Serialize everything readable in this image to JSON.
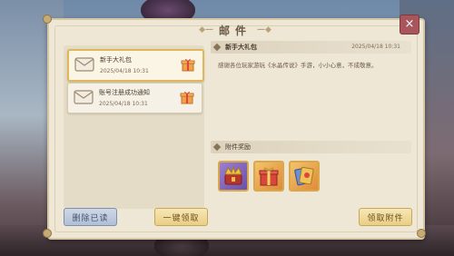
{
  "window": {
    "title": "邮件",
    "close_glyph": "×"
  },
  "mail_list": [
    {
      "title": "新手大礼包",
      "date": "2025/04/18 10:31",
      "selected": true,
      "has_attachment": true
    },
    {
      "title": "账号注册成功通知",
      "date": "2025/04/18 10:31",
      "selected": false,
      "has_attachment": true
    }
  ],
  "detail": {
    "title": "新手大礼包",
    "date": "2025/04/18 10:31",
    "body": "感谢各位玩家游玩《水晶传说》手游，小小心意，不成敬意。",
    "attachments_header": "附件奖励",
    "attachments": [
      {
        "icon": "crown-chest-icon",
        "slot_color": "purple"
      },
      {
        "icon": "gift-box-icon",
        "slot_color": "orange"
      },
      {
        "icon": "card-pack-icon",
        "slot_color": "orange"
      }
    ]
  },
  "buttons": {
    "delete_read": "删除已读",
    "claim_all": "一键领取",
    "claim_attachment": "领取附件"
  },
  "colors": {
    "panel_bg": "#efe7d6",
    "close_bg": "#a8555c",
    "gold_border": "#e0b85a"
  }
}
